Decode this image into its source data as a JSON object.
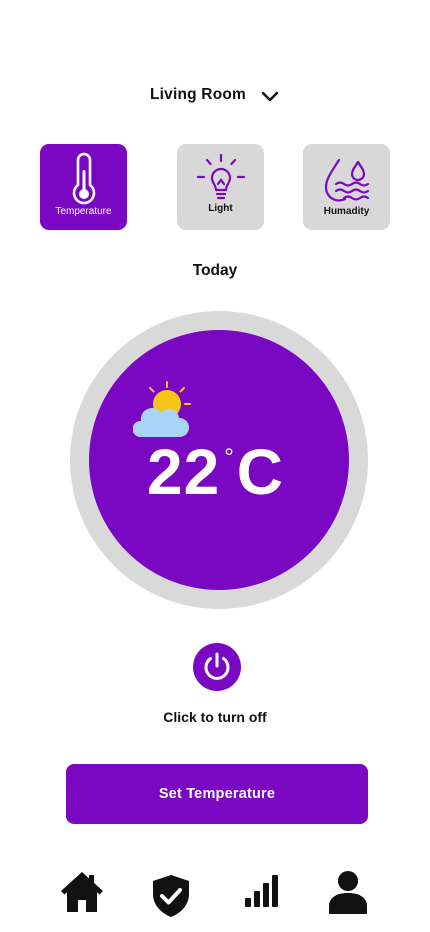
{
  "header": {
    "room_name": "Living Room",
    "chevron_icon": "chevron-down-icon"
  },
  "modes": [
    {
      "label": "Temperature",
      "icon": "thermometer-icon",
      "active": true
    },
    {
      "label": "Light",
      "icon": "lightbulb-icon",
      "active": false
    },
    {
      "label": "Humadity",
      "icon": "humidity-drop-icon",
      "active": false
    }
  ],
  "today_label": "Today",
  "dial": {
    "value": "22",
    "degree_symbol": "°",
    "unit": "C",
    "weather_icon": "partly-cloudy-icon"
  },
  "power": {
    "icon": "power-icon",
    "hint": "Click to turn off"
  },
  "set_temperature_label": "Set Temperature",
  "nav": [
    {
      "icon": "home-icon"
    },
    {
      "icon": "shield-check-icon"
    },
    {
      "icon": "signal-bars-icon"
    },
    {
      "icon": "user-icon"
    }
  ],
  "colors": {
    "accent": "#7a08c2",
    "tile_inactive": "#d8d8d8",
    "dial_ring": "#d9d9d9",
    "sun": "#f5c518",
    "cloud": "#a9d4f5"
  }
}
